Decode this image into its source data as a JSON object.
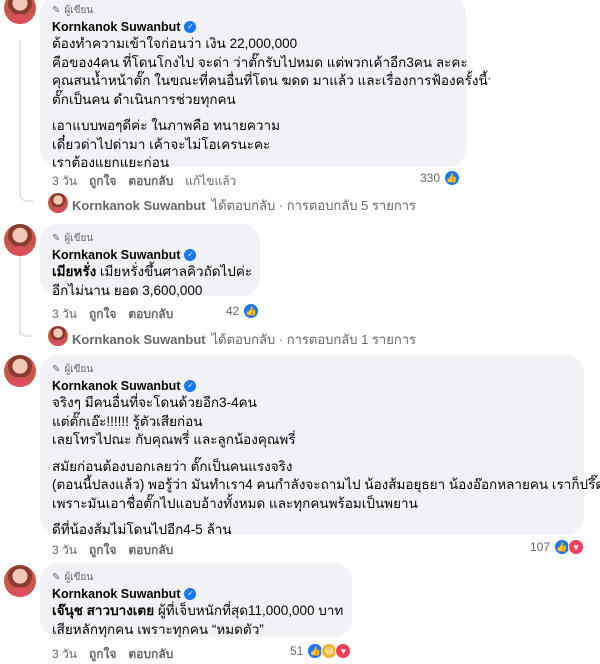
{
  "comments": [
    {
      "badge": "ผู้เขียน",
      "name": "Kornkanok Suwanbut",
      "lines": [
        "ต้องทำความเข้าใจก่อนว่า เงิน 22,000,000",
        "คือของ4คน ที่โดนโกงไป จะด่า ว่าตั๊กรับไปหมด แต่พวกเค้าอีก3คน ละคะ",
        "คุณสนน้ำหน้าตั๊ก ในขณะที่คนอื่นที่โดน ฆดด มาแล้ว และเรื่องการฟ้องครั้งนี้",
        "ตั๊กเป็นคน ดำเนินการช่วยทุกคน",
        "",
        "เอาแบบพอๆดีค่ะ ในภาพคือ ทนายความ",
        "เดี๋ยวด่าไปด่ามา เค้าจะไม่โอเครนะคะ",
        "เราต้องแยกแยะก่อน"
      ],
      "time": "3 วัน",
      "like": "ถูกใจ",
      "reply": "ตอบกลับ",
      "edited": "แก้ไขแล้ว",
      "reaction_count": "330",
      "replies_link": {
        "name": "Kornkanok Suwanbut",
        "text": "ได้ตอบกลับ · การตอบกลับ 5 รายการ"
      }
    },
    {
      "badge": "ผู้เขียน",
      "name": "Kornkanok Suwanbut",
      "lead": "เมียหรั่ง",
      "lines": [
        "เมียหรั่ง เมียหรั่งขึ้นศาลคิวถัดไปค่ะ",
        "อีกไม่นาน ยอด 3,600,000"
      ],
      "time": "3 วัน",
      "like": "ถูกใจ",
      "reply": "ตอบกลับ",
      "reaction_count": "42",
      "replies_link": {
        "name": "Kornkanok Suwanbut",
        "text": "ได้ตอบกลับ · การตอบกลับ 1 รายการ"
      }
    },
    {
      "badge": "ผู้เขียน",
      "name": "Kornkanok Suwanbut",
      "lines": [
        "จริงๆ มีคนอื่นที่จะโดนด้วยอีก3-4คน",
        "แต่ตั๊กเอ๊ะ!!!!!! รู้ตัวเสียก่อน",
        "เลยโทรไปณะ กับคุณพรี่ และลูกน้องคุณพรี่",
        "",
        "สมัยก่อนต้องบอกเลยว่า ตั๊กเป็นคนแรงจริง",
        "(ตอนนี้ปลงแล้ว) พอรู้ว่า มันทำเรา4 คนกำลังจะถามไป น้องส้มอยุธยา น้องอ๊อกหลายคน เราก็ปรึ๊ดต",
        "เพราะมันเอาชื่อตั๊กไปแอบอ้างทั้งหมด และทุกคนพร้อมเป็นพยาน",
        "",
        "ดีที่น้องส้มไม่โดนไปอีก4-5 ล้าน"
      ],
      "time": "3 วัน",
      "like": "ถูกใจ",
      "reply": "ตอบกลับ",
      "reaction_count": "107"
    },
    {
      "badge": "ผู้เขียน",
      "name": "Kornkanok Suwanbut",
      "lead": "เจ๊นุช สาวบางเตย",
      "lines": [
        "เจ๊นุช สาวบางเตย ผู้ที่เจ็บหนักที่สุด11,000,000 บาท",
        "เสียหลักทุกคน เพราะทุกคน “หมดตัว”"
      ],
      "time": "3 วัน",
      "like": "ถูกใจ",
      "reply": "ตอบกลับ",
      "reaction_count": "51"
    }
  ],
  "colors": {
    "bubble": "#f0f2f5",
    "accent": "#1877f2",
    "muted": "#65676b"
  }
}
